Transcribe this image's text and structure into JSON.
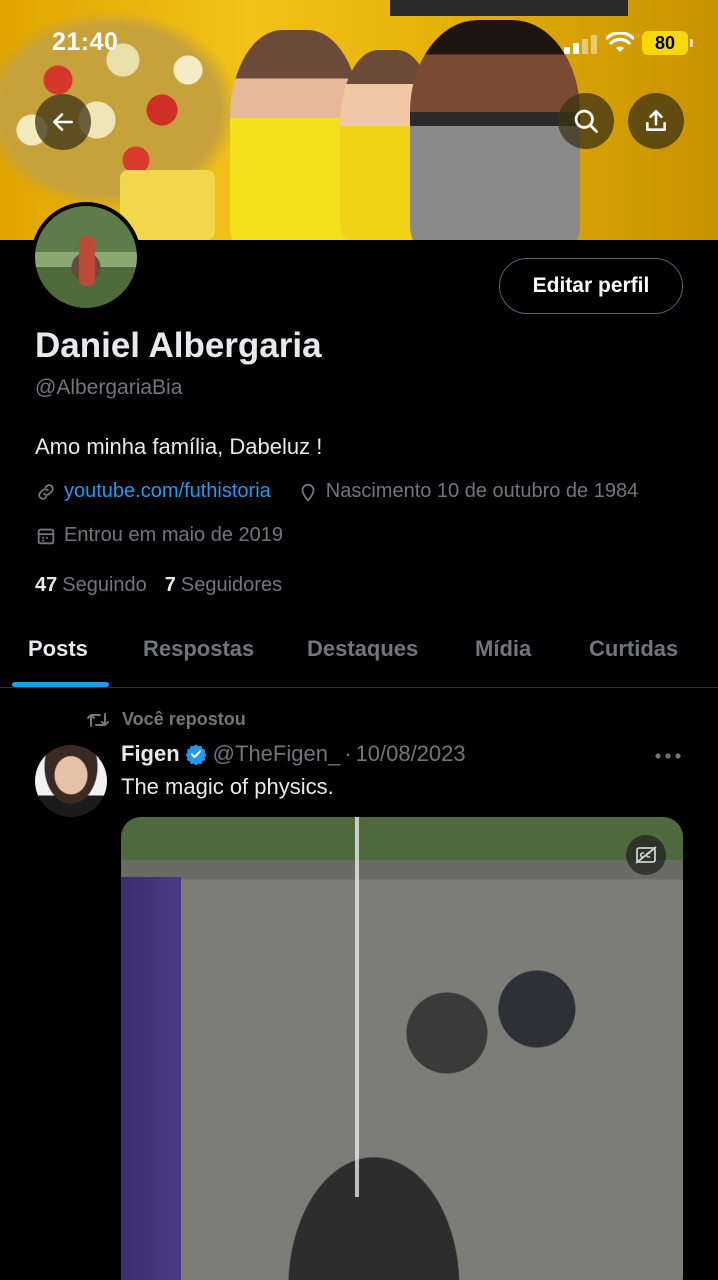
{
  "status_bar": {
    "time": "21:40",
    "battery": "80"
  },
  "profile": {
    "edit_label": "Editar perfil",
    "name": "Daniel Albergaria",
    "handle": "@AlbergariaBia",
    "bio": "Amo minha família, Dabeluz !",
    "link": "youtube.com/futhistoria",
    "birth": "Nascimento 10 de outubro de 1984",
    "joined": "Entrou em maio de 2019",
    "following_count": "47",
    "following_label": "Seguindo",
    "followers_count": "7",
    "followers_label": "Seguidores"
  },
  "tabs": [
    {
      "label": "Posts",
      "active": true
    },
    {
      "label": "Respostas"
    },
    {
      "label": "Destaques"
    },
    {
      "label": "Mídia"
    },
    {
      "label": "Curtidas"
    }
  ],
  "post": {
    "repost_label": "Você repostou",
    "author": "Figen",
    "handle": "@TheFigen_",
    "separator": "·",
    "date": "10/08/2023",
    "text": "The magic of physics."
  },
  "colors": {
    "accent": "#1d9bf0",
    "background": "#000000",
    "muted": "#71767b",
    "battery": "#f5d90a"
  },
  "icons": [
    "back-arrow-icon",
    "search-icon",
    "share-icon",
    "link-icon",
    "location-icon",
    "calendar-icon",
    "repost-icon",
    "verified-icon",
    "more-icon",
    "captions-off-icon"
  ]
}
